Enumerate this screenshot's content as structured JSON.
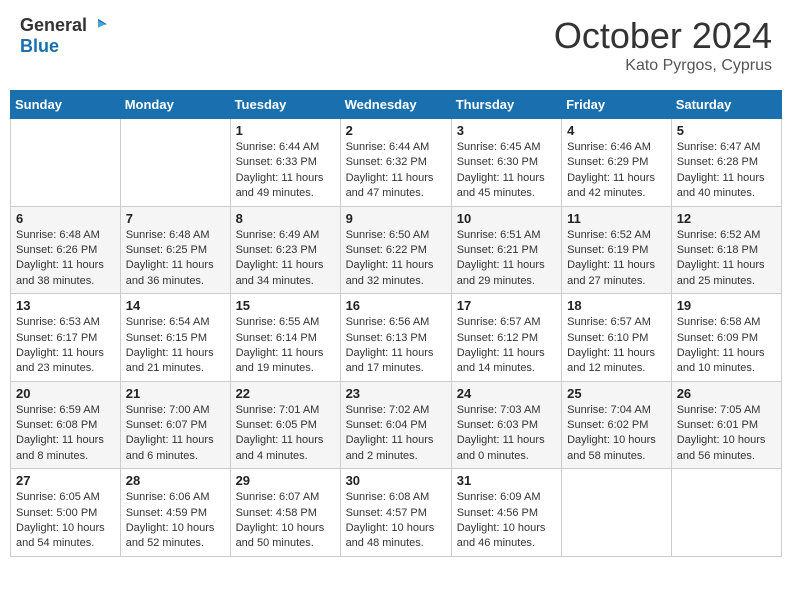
{
  "header": {
    "logo_general": "General",
    "logo_blue": "Blue",
    "month_year": "October 2024",
    "location": "Kato Pyrgos, Cyprus"
  },
  "days_of_week": [
    "Sunday",
    "Monday",
    "Tuesday",
    "Wednesday",
    "Thursday",
    "Friday",
    "Saturday"
  ],
  "weeks": [
    [
      {
        "day": "",
        "sunrise": "",
        "sunset": "",
        "daylight": ""
      },
      {
        "day": "",
        "sunrise": "",
        "sunset": "",
        "daylight": ""
      },
      {
        "day": "1",
        "sunrise": "Sunrise: 6:44 AM",
        "sunset": "Sunset: 6:33 PM",
        "daylight": "Daylight: 11 hours and 49 minutes."
      },
      {
        "day": "2",
        "sunrise": "Sunrise: 6:44 AM",
        "sunset": "Sunset: 6:32 PM",
        "daylight": "Daylight: 11 hours and 47 minutes."
      },
      {
        "day": "3",
        "sunrise": "Sunrise: 6:45 AM",
        "sunset": "Sunset: 6:30 PM",
        "daylight": "Daylight: 11 hours and 45 minutes."
      },
      {
        "day": "4",
        "sunrise": "Sunrise: 6:46 AM",
        "sunset": "Sunset: 6:29 PM",
        "daylight": "Daylight: 11 hours and 42 minutes."
      },
      {
        "day": "5",
        "sunrise": "Sunrise: 6:47 AM",
        "sunset": "Sunset: 6:28 PM",
        "daylight": "Daylight: 11 hours and 40 minutes."
      }
    ],
    [
      {
        "day": "6",
        "sunrise": "Sunrise: 6:48 AM",
        "sunset": "Sunset: 6:26 PM",
        "daylight": "Daylight: 11 hours and 38 minutes."
      },
      {
        "day": "7",
        "sunrise": "Sunrise: 6:48 AM",
        "sunset": "Sunset: 6:25 PM",
        "daylight": "Daylight: 11 hours and 36 minutes."
      },
      {
        "day": "8",
        "sunrise": "Sunrise: 6:49 AM",
        "sunset": "Sunset: 6:23 PM",
        "daylight": "Daylight: 11 hours and 34 minutes."
      },
      {
        "day": "9",
        "sunrise": "Sunrise: 6:50 AM",
        "sunset": "Sunset: 6:22 PM",
        "daylight": "Daylight: 11 hours and 32 minutes."
      },
      {
        "day": "10",
        "sunrise": "Sunrise: 6:51 AM",
        "sunset": "Sunset: 6:21 PM",
        "daylight": "Daylight: 11 hours and 29 minutes."
      },
      {
        "day": "11",
        "sunrise": "Sunrise: 6:52 AM",
        "sunset": "Sunset: 6:19 PM",
        "daylight": "Daylight: 11 hours and 27 minutes."
      },
      {
        "day": "12",
        "sunrise": "Sunrise: 6:52 AM",
        "sunset": "Sunset: 6:18 PM",
        "daylight": "Daylight: 11 hours and 25 minutes."
      }
    ],
    [
      {
        "day": "13",
        "sunrise": "Sunrise: 6:53 AM",
        "sunset": "Sunset: 6:17 PM",
        "daylight": "Daylight: 11 hours and 23 minutes."
      },
      {
        "day": "14",
        "sunrise": "Sunrise: 6:54 AM",
        "sunset": "Sunset: 6:15 PM",
        "daylight": "Daylight: 11 hours and 21 minutes."
      },
      {
        "day": "15",
        "sunrise": "Sunrise: 6:55 AM",
        "sunset": "Sunset: 6:14 PM",
        "daylight": "Daylight: 11 hours and 19 minutes."
      },
      {
        "day": "16",
        "sunrise": "Sunrise: 6:56 AM",
        "sunset": "Sunset: 6:13 PM",
        "daylight": "Daylight: 11 hours and 17 minutes."
      },
      {
        "day": "17",
        "sunrise": "Sunrise: 6:57 AM",
        "sunset": "Sunset: 6:12 PM",
        "daylight": "Daylight: 11 hours and 14 minutes."
      },
      {
        "day": "18",
        "sunrise": "Sunrise: 6:57 AM",
        "sunset": "Sunset: 6:10 PM",
        "daylight": "Daylight: 11 hours and 12 minutes."
      },
      {
        "day": "19",
        "sunrise": "Sunrise: 6:58 AM",
        "sunset": "Sunset: 6:09 PM",
        "daylight": "Daylight: 11 hours and 10 minutes."
      }
    ],
    [
      {
        "day": "20",
        "sunrise": "Sunrise: 6:59 AM",
        "sunset": "Sunset: 6:08 PM",
        "daylight": "Daylight: 11 hours and 8 minutes."
      },
      {
        "day": "21",
        "sunrise": "Sunrise: 7:00 AM",
        "sunset": "Sunset: 6:07 PM",
        "daylight": "Daylight: 11 hours and 6 minutes."
      },
      {
        "day": "22",
        "sunrise": "Sunrise: 7:01 AM",
        "sunset": "Sunset: 6:05 PM",
        "daylight": "Daylight: 11 hours and 4 minutes."
      },
      {
        "day": "23",
        "sunrise": "Sunrise: 7:02 AM",
        "sunset": "Sunset: 6:04 PM",
        "daylight": "Daylight: 11 hours and 2 minutes."
      },
      {
        "day": "24",
        "sunrise": "Sunrise: 7:03 AM",
        "sunset": "Sunset: 6:03 PM",
        "daylight": "Daylight: 11 hours and 0 minutes."
      },
      {
        "day": "25",
        "sunrise": "Sunrise: 7:04 AM",
        "sunset": "Sunset: 6:02 PM",
        "daylight": "Daylight: 10 hours and 58 minutes."
      },
      {
        "day": "26",
        "sunrise": "Sunrise: 7:05 AM",
        "sunset": "Sunset: 6:01 PM",
        "daylight": "Daylight: 10 hours and 56 minutes."
      }
    ],
    [
      {
        "day": "27",
        "sunrise": "Sunrise: 6:05 AM",
        "sunset": "Sunset: 5:00 PM",
        "daylight": "Daylight: 10 hours and 54 minutes."
      },
      {
        "day": "28",
        "sunrise": "Sunrise: 6:06 AM",
        "sunset": "Sunset: 4:59 PM",
        "daylight": "Daylight: 10 hours and 52 minutes."
      },
      {
        "day": "29",
        "sunrise": "Sunrise: 6:07 AM",
        "sunset": "Sunset: 4:58 PM",
        "daylight": "Daylight: 10 hours and 50 minutes."
      },
      {
        "day": "30",
        "sunrise": "Sunrise: 6:08 AM",
        "sunset": "Sunset: 4:57 PM",
        "daylight": "Daylight: 10 hours and 48 minutes."
      },
      {
        "day": "31",
        "sunrise": "Sunrise: 6:09 AM",
        "sunset": "Sunset: 4:56 PM",
        "daylight": "Daylight: 10 hours and 46 minutes."
      },
      {
        "day": "",
        "sunrise": "",
        "sunset": "",
        "daylight": ""
      },
      {
        "day": "",
        "sunrise": "",
        "sunset": "",
        "daylight": ""
      }
    ]
  ]
}
